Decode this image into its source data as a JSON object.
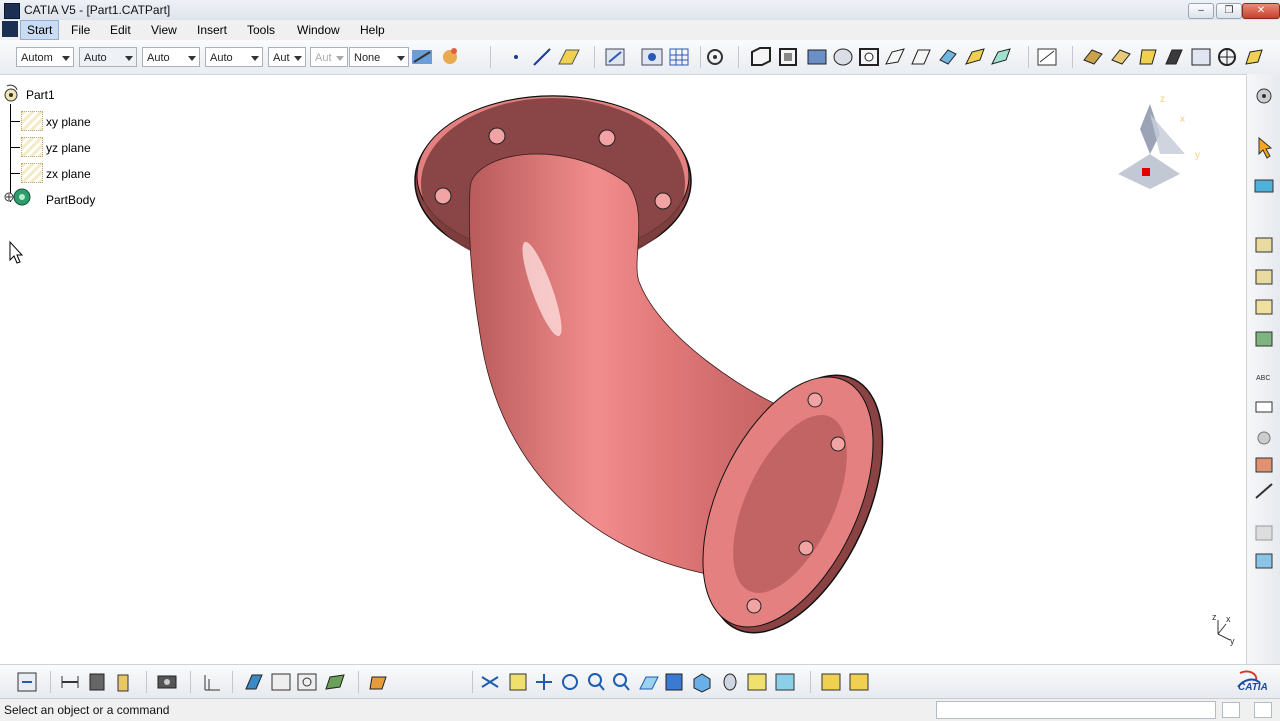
{
  "window": {
    "title": "CATIA V5 - [Part1.CATPart]"
  },
  "menu": {
    "items": [
      {
        "label": "Start"
      },
      {
        "label": "File"
      },
      {
        "label": "Edit"
      },
      {
        "label": "View"
      },
      {
        "label": "Insert"
      },
      {
        "label": "Tools"
      },
      {
        "label": "Window"
      },
      {
        "label": "Help"
      }
    ]
  },
  "graphic_props": {
    "color": "Autom",
    "transparency": "Auto",
    "thickness": "Auto",
    "linetype": "Auto",
    "point_symbol": "Aut",
    "rendering": "Aut",
    "layer": "None"
  },
  "tree": {
    "root": "Part1",
    "items": [
      {
        "label": "xy plane"
      },
      {
        "label": "yz plane"
      },
      {
        "label": "zx plane"
      },
      {
        "label": "PartBody"
      }
    ]
  },
  "compass": {
    "x": "x",
    "y": "y",
    "z": "z"
  },
  "axis_triad": {
    "x": "x",
    "y": "y",
    "z": "z"
  },
  "brand": {
    "logo": "CATIA"
  },
  "status": {
    "message": "Select an object or a command"
  },
  "colors": {
    "part": "#e07878",
    "part_dark": "#8a4242",
    "accent_active": "#c9dcf3"
  }
}
